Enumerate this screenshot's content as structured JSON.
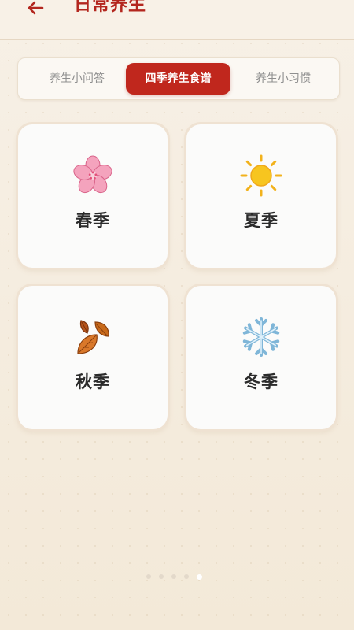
{
  "header": {
    "title": "日常养生",
    "back_icon": "arrow-left-icon"
  },
  "tabs": [
    {
      "label": "养生小问答",
      "active": false
    },
    {
      "label": "四季养生食谱",
      "active": true
    },
    {
      "label": "养生小习惯",
      "active": false
    }
  ],
  "seasons": [
    {
      "label": "春季",
      "icon": "cherry-blossom-icon"
    },
    {
      "label": "夏季",
      "icon": "sun-icon"
    },
    {
      "label": "秋季",
      "icon": "fallen-leaves-icon"
    },
    {
      "label": "冬季",
      "icon": "snowflake-icon"
    }
  ],
  "pager": {
    "count": 5,
    "active_index": 4
  },
  "colors": {
    "accent": "#c0271d",
    "title": "#b3261e",
    "background": "#f5ecdd",
    "card": "#fbfbfa"
  }
}
